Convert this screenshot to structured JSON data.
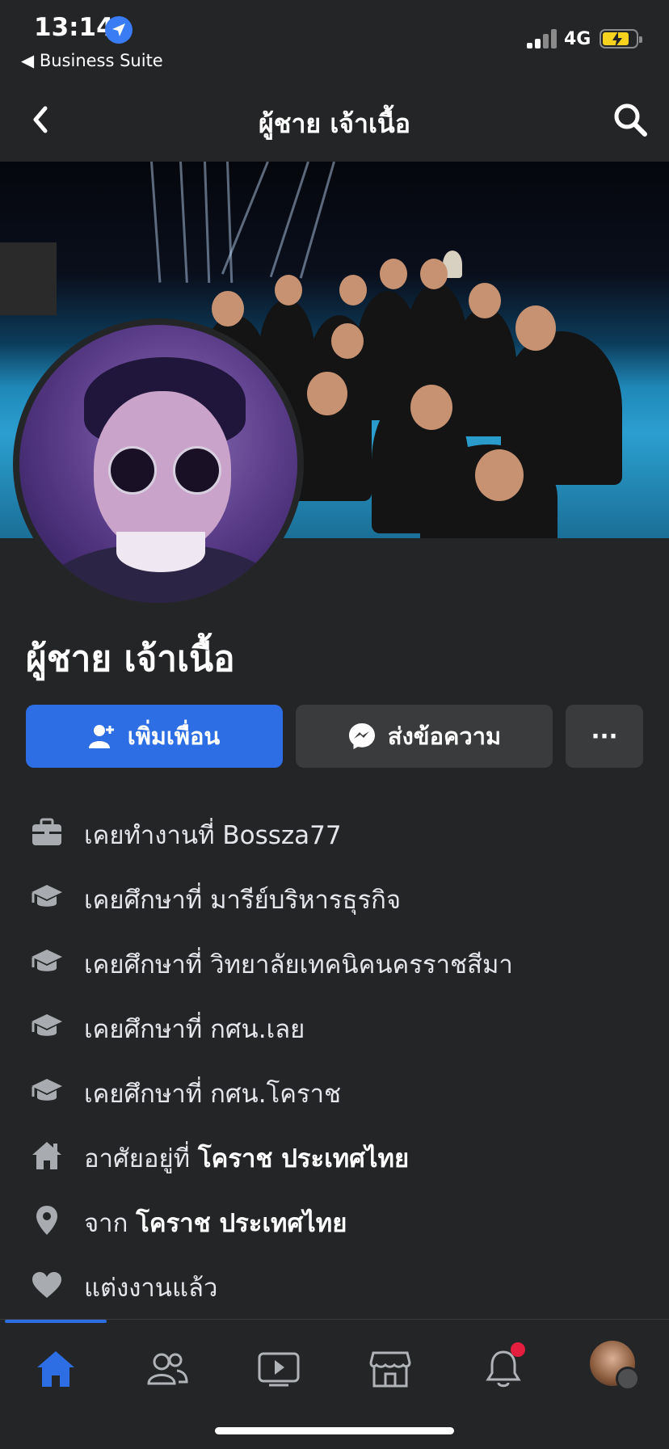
{
  "status_bar": {
    "time": "13:14",
    "back_app": "◀ Business Suite",
    "network": "4G"
  },
  "header": {
    "title": "ผู้ชาย เจ้าเนื้อ"
  },
  "profile": {
    "name": "ผู้ชาย เจ้าเนื้อ"
  },
  "actions": {
    "add_friend": "เพิ่มเพื่อน",
    "message": "ส่งข้อความ",
    "more": "···"
  },
  "info": [
    {
      "icon": "briefcase-icon",
      "prefix": "เคยทำงานที่ ",
      "value": "Bossza77",
      "bold": false
    },
    {
      "icon": "graduation-cap-icon",
      "prefix": "เคยศึกษาที่ ",
      "value": "มารีย์บริหารธุรกิจ",
      "bold": false
    },
    {
      "icon": "graduation-cap-icon",
      "prefix": "เคยศึกษาที่ ",
      "value": "วิทยาลัยเทคนิคนครราชสีมา",
      "bold": false
    },
    {
      "icon": "graduation-cap-icon",
      "prefix": "เคยศึกษาที่ ",
      "value": "กศน.เลย",
      "bold": false
    },
    {
      "icon": "graduation-cap-icon",
      "prefix": "เคยศึกษาที่ ",
      "value": "กศน.โคราช",
      "bold": false
    },
    {
      "icon": "house-icon",
      "prefix": "อาศัยอยู่ที่ ",
      "value": "โคราช ประเทศไทย",
      "bold": true
    },
    {
      "icon": "location-pin-icon",
      "prefix": "จาก ",
      "value": "โคราช ประเทศไทย",
      "bold": true
    },
    {
      "icon": "heart-icon",
      "prefix": "",
      "value": "แต่งงานแล้ว",
      "bold": false
    }
  ],
  "colors": {
    "background": "#242526",
    "primary_button": "#2d6ee4",
    "secondary_button": "#3a3b3c",
    "notification": "#e41e3f"
  }
}
